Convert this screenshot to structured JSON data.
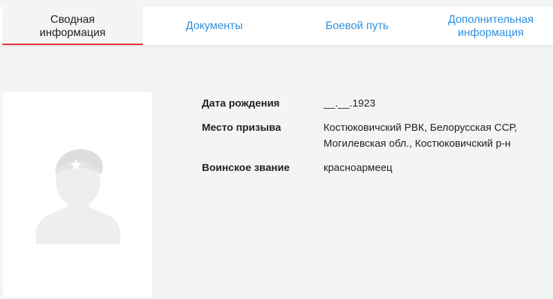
{
  "tabs": [
    {
      "label": "Сводная информация",
      "active": true
    },
    {
      "label": "Документы",
      "active": false
    },
    {
      "label": "Боевой путь",
      "active": false
    },
    {
      "label": "Дополнительная информация",
      "active": false
    }
  ],
  "colors": {
    "accent": "#e3262f",
    "link": "#2d8fe0",
    "background": "#f4f4f4"
  },
  "photo": {
    "icon": "soldier-silhouette-icon"
  },
  "info": {
    "birth_date": {
      "label": "Дата рождения",
      "value": "__.__.1923"
    },
    "draft_place": {
      "label": "Место призыва",
      "value": "Костюковичский РВК, Белорусская ССР,\nМогилевская обл., Костюковичский р-н"
    },
    "rank": {
      "label": "Воинское звание",
      "value": "красноармеец"
    }
  }
}
